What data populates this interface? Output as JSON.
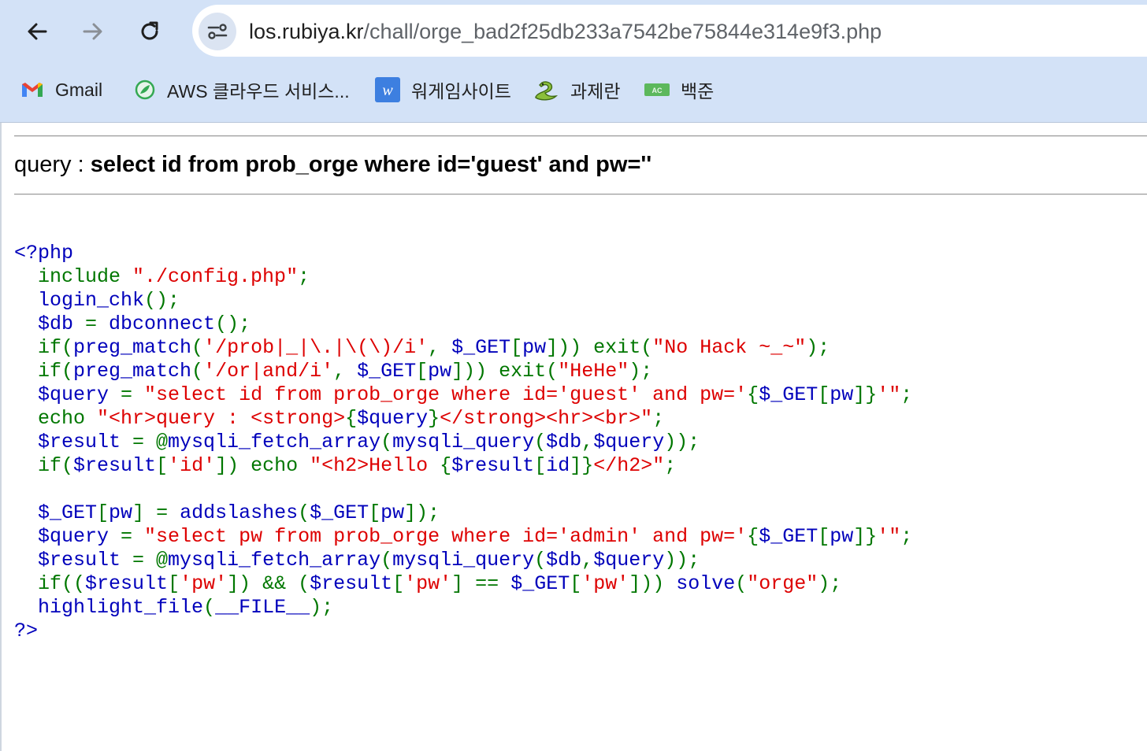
{
  "browser": {
    "url_host": "los.rubiya.kr",
    "url_path": "/chall/orge_bad2f25db233a7542be75844e314e9f3.php",
    "bookmarks": [
      {
        "label": "Gmail",
        "icon": "gmail-icon"
      },
      {
        "label": "AWS 클라우드 서비스...",
        "icon": "aws-leaf-icon"
      },
      {
        "label": "워게임사이트",
        "icon": "w-icon"
      },
      {
        "label": "과제란",
        "icon": "python-icon"
      },
      {
        "label": "백준",
        "icon": "ac-icon"
      }
    ],
    "colors": {
      "toolbar": "#d3e2f7",
      "omnibox": "#ffffff"
    }
  },
  "page": {
    "query_label": "query : ",
    "query_text": "select id from prob_orge where id='guest' and pw=''",
    "code_colors": {
      "default": "#0000bb",
      "keyword": "#007700",
      "string": "#dd0000"
    },
    "code_lines": [
      [
        [
          "d",
          "<?php"
        ]
      ],
      [
        [
          "g",
          "  include "
        ],
        [
          "r",
          "\"./config.php\""
        ],
        [
          "g",
          ";"
        ]
      ],
      [
        [
          "d",
          "  login_chk"
        ],
        [
          "g",
          "();"
        ]
      ],
      [
        [
          "d",
          "  $db "
        ],
        [
          "g",
          "= "
        ],
        [
          "d",
          "dbconnect"
        ],
        [
          "g",
          "();"
        ]
      ],
      [
        [
          "g",
          "  if("
        ],
        [
          "d",
          "preg_match"
        ],
        [
          "g",
          "("
        ],
        [
          "r",
          "'/prob|_|\\.|\\(\\)/i'"
        ],
        [
          "g",
          ", "
        ],
        [
          "d",
          "$_GET"
        ],
        [
          "g",
          "["
        ],
        [
          "d",
          "pw"
        ],
        [
          "g",
          "])) exit("
        ],
        [
          "r",
          "\"No Hack ~_~\""
        ],
        [
          "g",
          ");"
        ]
      ],
      [
        [
          "g",
          "  if("
        ],
        [
          "d",
          "preg_match"
        ],
        [
          "g",
          "("
        ],
        [
          "r",
          "'/or|and/i'"
        ],
        [
          "g",
          ", "
        ],
        [
          "d",
          "$_GET"
        ],
        [
          "g",
          "["
        ],
        [
          "d",
          "pw"
        ],
        [
          "g",
          "])) exit("
        ],
        [
          "r",
          "\"HeHe\""
        ],
        [
          "g",
          ");"
        ]
      ],
      [
        [
          "d",
          "  $query "
        ],
        [
          "g",
          "= "
        ],
        [
          "r",
          "\"select id from prob_orge where id='guest' and pw='"
        ],
        [
          "g",
          "{"
        ],
        [
          "d",
          "$_GET"
        ],
        [
          "g",
          "["
        ],
        [
          "d",
          "pw"
        ],
        [
          "g",
          "]}"
        ],
        [
          "r",
          "'\""
        ],
        [
          "g",
          ";"
        ]
      ],
      [
        [
          "g",
          "  echo "
        ],
        [
          "r",
          "\"<hr>query : <strong>"
        ],
        [
          "g",
          "{"
        ],
        [
          "d",
          "$query"
        ],
        [
          "g",
          "}"
        ],
        [
          "r",
          "</strong><hr><br>\""
        ],
        [
          "g",
          ";"
        ]
      ],
      [
        [
          "d",
          "  $result "
        ],
        [
          "g",
          "= @"
        ],
        [
          "d",
          "mysqli_fetch_array"
        ],
        [
          "g",
          "("
        ],
        [
          "d",
          "mysqli_query"
        ],
        [
          "g",
          "("
        ],
        [
          "d",
          "$db"
        ],
        [
          "g",
          ","
        ],
        [
          "d",
          "$query"
        ],
        [
          "g",
          "));"
        ]
      ],
      [
        [
          "g",
          "  if("
        ],
        [
          "d",
          "$result"
        ],
        [
          "g",
          "["
        ],
        [
          "r",
          "'id'"
        ],
        [
          "g",
          "]) echo "
        ],
        [
          "r",
          "\"<h2>Hello "
        ],
        [
          "g",
          "{"
        ],
        [
          "d",
          "$result"
        ],
        [
          "g",
          "["
        ],
        [
          "d",
          "id"
        ],
        [
          "g",
          "]}"
        ],
        [
          "r",
          "</h2>\""
        ],
        [
          "g",
          ";"
        ]
      ],
      [
        [
          "d",
          ""
        ]
      ],
      [
        [
          "d",
          "  $_GET"
        ],
        [
          "g",
          "["
        ],
        [
          "d",
          "pw"
        ],
        [
          "g",
          "] = "
        ],
        [
          "d",
          "addslashes"
        ],
        [
          "g",
          "("
        ],
        [
          "d",
          "$_GET"
        ],
        [
          "g",
          "["
        ],
        [
          "d",
          "pw"
        ],
        [
          "g",
          "]);"
        ]
      ],
      [
        [
          "d",
          "  $query "
        ],
        [
          "g",
          "= "
        ],
        [
          "r",
          "\"select pw from prob_orge where id='admin' and pw='"
        ],
        [
          "g",
          "{"
        ],
        [
          "d",
          "$_GET"
        ],
        [
          "g",
          "["
        ],
        [
          "d",
          "pw"
        ],
        [
          "g",
          "]}"
        ],
        [
          "r",
          "'\""
        ],
        [
          "g",
          ";"
        ]
      ],
      [
        [
          "d",
          "  $result "
        ],
        [
          "g",
          "= @"
        ],
        [
          "d",
          "mysqli_fetch_array"
        ],
        [
          "g",
          "("
        ],
        [
          "d",
          "mysqli_query"
        ],
        [
          "g",
          "("
        ],
        [
          "d",
          "$db"
        ],
        [
          "g",
          ","
        ],
        [
          "d",
          "$query"
        ],
        [
          "g",
          "));"
        ]
      ],
      [
        [
          "g",
          "  if(("
        ],
        [
          "d",
          "$result"
        ],
        [
          "g",
          "["
        ],
        [
          "r",
          "'pw'"
        ],
        [
          "g",
          "]) && ("
        ],
        [
          "d",
          "$result"
        ],
        [
          "g",
          "["
        ],
        [
          "r",
          "'pw'"
        ],
        [
          "g",
          "] == "
        ],
        [
          "d",
          "$_GET"
        ],
        [
          "g",
          "["
        ],
        [
          "r",
          "'pw'"
        ],
        [
          "g",
          "])) "
        ],
        [
          "d",
          "solve"
        ],
        [
          "g",
          "("
        ],
        [
          "r",
          "\"orge\""
        ],
        [
          "g",
          ");"
        ]
      ],
      [
        [
          "d",
          "  highlight_file"
        ],
        [
          "g",
          "("
        ],
        [
          "d",
          "__FILE__"
        ],
        [
          "g",
          ");"
        ]
      ],
      [
        [
          "d",
          "?>"
        ]
      ]
    ]
  }
}
